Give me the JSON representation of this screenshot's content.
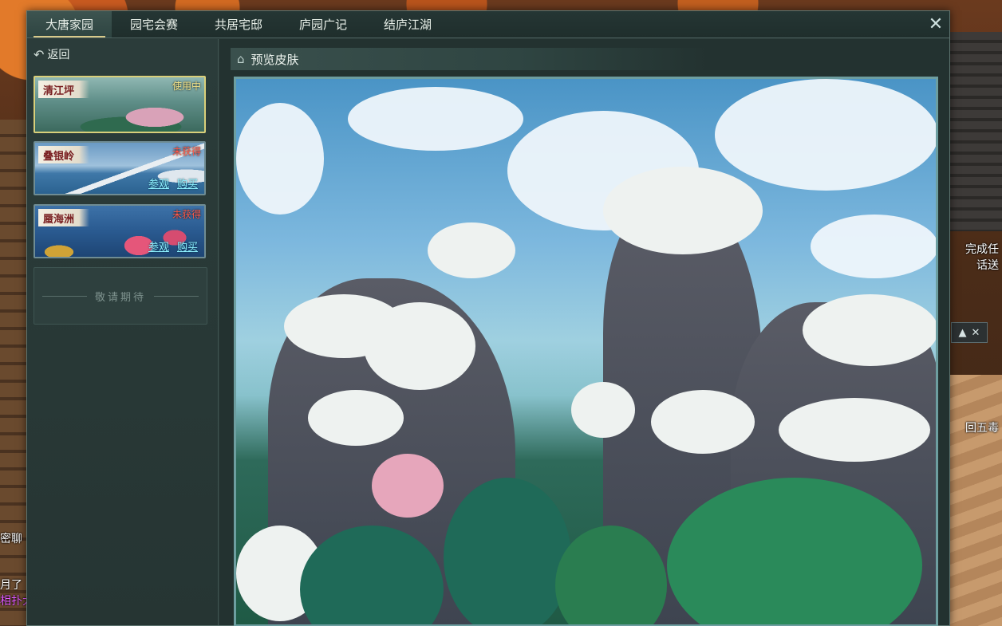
{
  "tabs": [
    {
      "label": "大唐家园",
      "active": true
    },
    {
      "label": "园宅会赛",
      "active": false
    },
    {
      "label": "共居宅邸",
      "active": false
    },
    {
      "label": "庐园广记",
      "active": false
    },
    {
      "label": "结庐江湖",
      "active": false
    }
  ],
  "close_icon": "close-icon",
  "sidebar": {
    "back_label": "返回",
    "skins": [
      {
        "name": "清江坪",
        "status": "使用中",
        "selected": true
      },
      {
        "name": "叠银岭",
        "status": "未获得",
        "view_label": "参观",
        "buy_label": "购买"
      },
      {
        "name": "蜃海洲",
        "status": "未获得",
        "view_label": "参观",
        "buy_label": "购买"
      }
    ],
    "coming_soon": "敬请期待"
  },
  "preview": {
    "title": "预览皮肤"
  },
  "world_hud": {
    "right_line1": "完成任",
    "right_line2": "话送",
    "right_line3": "回五毒",
    "left_line1": "密聊",
    "left_line2": "月了",
    "left_line3": "相扑大"
  },
  "colors": {
    "accent_gold": "#d9cf7a",
    "status_in_use": "#f2e38a",
    "status_locked": "#ff5a4a",
    "link_cyan": "#8ef0ff"
  }
}
